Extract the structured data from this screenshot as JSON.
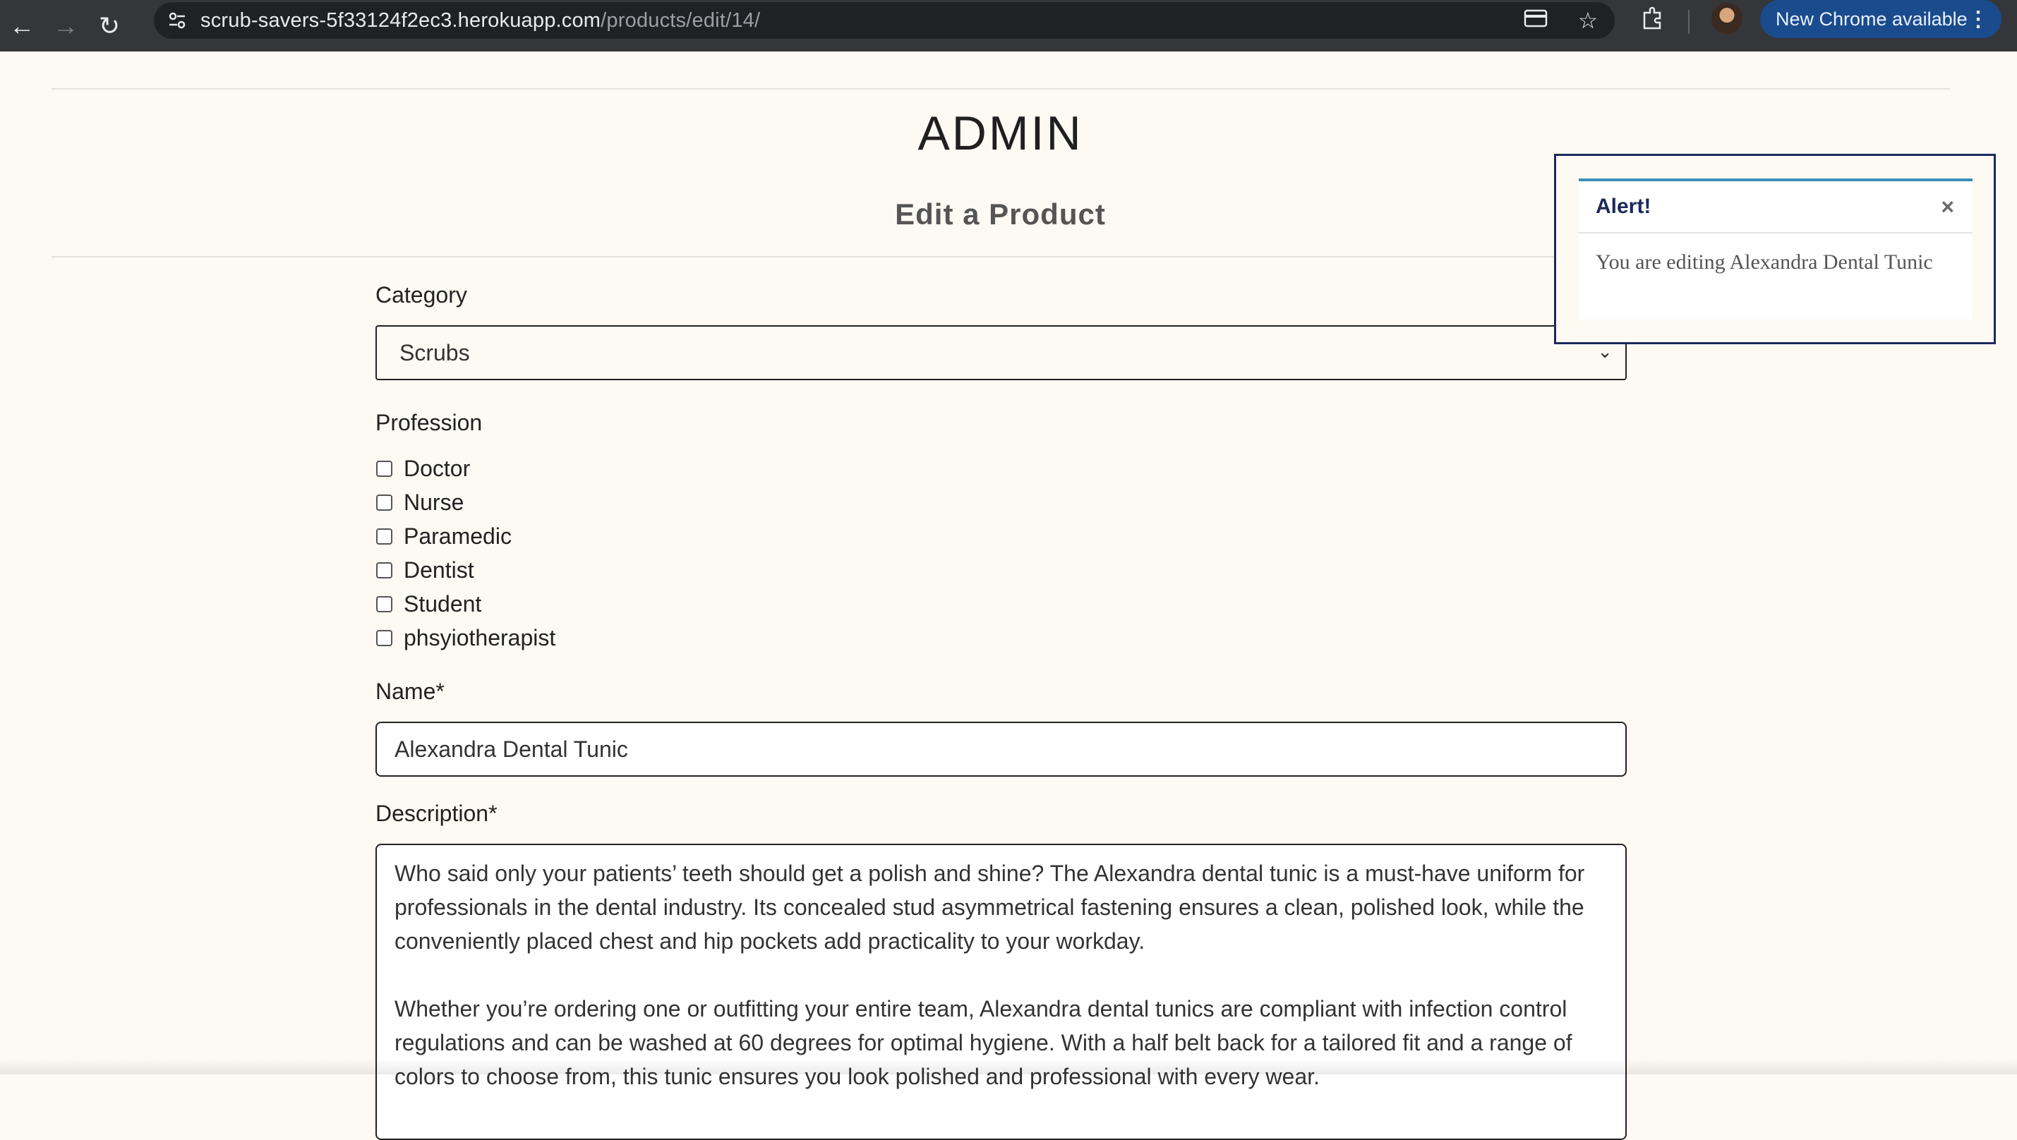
{
  "browser": {
    "url_host": "scrub-savers-5f33124f2ec3.herokuapp.com",
    "url_path": "/products/edit/14/",
    "update_label": "New Chrome available"
  },
  "page": {
    "title": "ADMIN",
    "subtitle": "Edit a Product"
  },
  "form": {
    "category_label": "Category",
    "category_value": "Scrubs",
    "profession_label": "Profession",
    "professions": [
      "Doctor",
      "Nurse",
      "Paramedic",
      "Dentist",
      "Student",
      "phsyiotherapist"
    ],
    "name_label": "Name*",
    "name_value": "Alexandra Dental Tunic",
    "description_label": "Description*",
    "description_p1": "Who said only your patients’ teeth should get a polish and shine? The Alexandra dental tunic is a must-have uniform for professionals in the dental industry. Its concealed stud asymmetrical fastening ensures a clean, polished look, while the conveniently placed chest and hip pockets add practicality to your workday.",
    "description_p2": "Whether you’re ordering one or outfitting your entire team, Alexandra dental tunics are compliant with infection control regulations and can be washed at 60 degrees for optimal hygiene. With a half belt back for a tailored fit and a range of colors to choose from, this tunic ensures you look polished and professional with every wear."
  },
  "alert": {
    "title": "Alert!",
    "message": "You are editing Alexandra Dental Tunic"
  }
}
